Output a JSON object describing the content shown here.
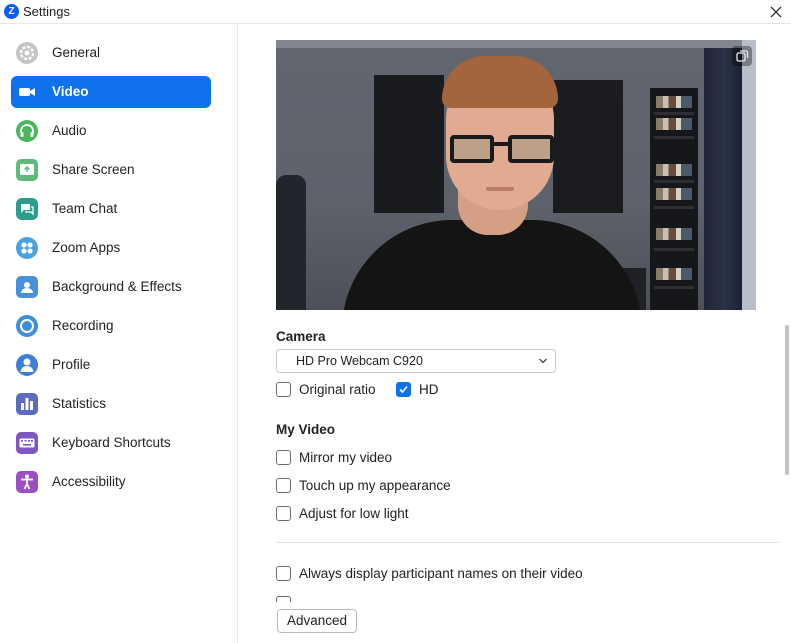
{
  "window": {
    "title": "Settings",
    "logo_letter": "Z",
    "accent_color": "#0e72ed"
  },
  "sidebar": {
    "items": [
      {
        "label": "General",
        "icon": "gear-icon",
        "color": "#b8b8b8",
        "active": false
      },
      {
        "label": "Video",
        "icon": "video-camera-icon",
        "color": "#ffffff",
        "active": true
      },
      {
        "label": "Audio",
        "icon": "headphones-icon",
        "color": "#4bb65c",
        "active": false
      },
      {
        "label": "Share Screen",
        "icon": "share-screen-icon",
        "color": "#5ebb7b",
        "active": false
      },
      {
        "label": "Team Chat",
        "icon": "chat-bubble-icon",
        "color": "#2a9d8f",
        "active": false
      },
      {
        "label": "Zoom Apps",
        "icon": "apps-icon",
        "color": "#4aa3df",
        "active": false
      },
      {
        "label": "Background & Effects",
        "icon": "background-person-icon",
        "color": "#4a90d9",
        "active": false
      },
      {
        "label": "Recording",
        "icon": "recording-icon",
        "color": "#3f8fd8",
        "active": false
      },
      {
        "label": "Profile",
        "icon": "profile-person-icon",
        "color": "#3d7fd6",
        "active": false
      },
      {
        "label": "Statistics",
        "icon": "bar-chart-icon",
        "color": "#5c6bc0",
        "active": false
      },
      {
        "label": "Keyboard Shortcuts",
        "icon": "keyboard-icon",
        "color": "#7e57c2",
        "active": false
      },
      {
        "label": "Accessibility",
        "icon": "accessibility-icon",
        "color": "#9c4fc4",
        "active": false
      }
    ]
  },
  "main": {
    "camera": {
      "heading": "Camera",
      "selected_device": "HD Pro Webcam C920",
      "original_ratio": {
        "label": "Original ratio",
        "checked": false
      },
      "hd": {
        "label": "HD",
        "checked": true
      }
    },
    "my_video": {
      "heading": "My Video",
      "options": [
        {
          "label": "Mirror my video",
          "checked": false
        },
        {
          "label": "Touch up my appearance",
          "checked": false
        },
        {
          "label": "Adjust for low light",
          "checked": false
        }
      ]
    },
    "always_display_names": {
      "label": "Always display participant names on their video",
      "checked": false
    },
    "advanced_label": "Advanced"
  }
}
